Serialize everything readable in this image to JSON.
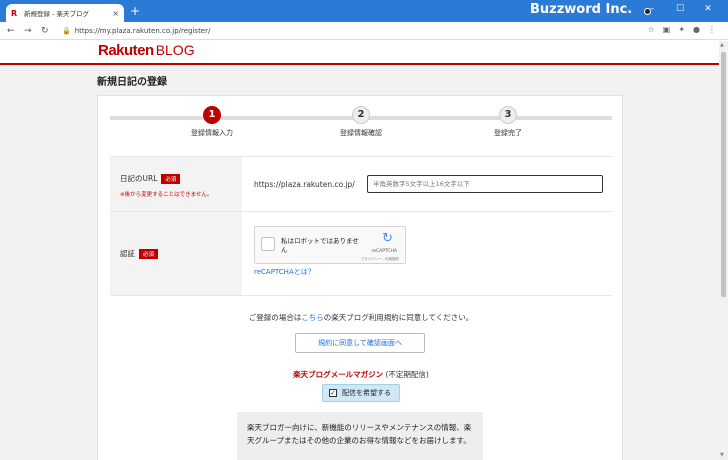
{
  "browser": {
    "tab_title": "新規登録 - 楽天ブログ",
    "tab_favicon": "R",
    "close_glyph": "×",
    "newtab_glyph": "+",
    "url": "https://my.plaza.rakuten.co.jp/register/",
    "watermark": "Buzzword Inc.",
    "min_glyph": "–",
    "max_glyph": "☐",
    "winclose_glyph": "✕",
    "back_glyph": "←",
    "forward_glyph": "→",
    "reload_glyph": "↻",
    "lock_glyph": "🔒",
    "star_glyph": "☆",
    "ext1_glyph": "▣",
    "ext2_glyph": "✦",
    "ext3_glyph": "●",
    "menu_glyph": "⋮"
  },
  "header": {
    "logo_main": "Rakuten",
    "logo_sub": "BLOG"
  },
  "page_title": "新規日記の登録",
  "steps": [
    {
      "number": "1",
      "label": "登録情報入力"
    },
    {
      "number": "2",
      "label": "登録情報確認"
    },
    {
      "number": "3",
      "label": "登録完了"
    }
  ],
  "form": {
    "url_label": "日記のURL",
    "required": "必須",
    "url_note": "※後から変更することはできません。",
    "url_prefix": "https://plaza.rakuten.co.jp/",
    "url_placeholder": "半角英数字5文字以上16文字以下",
    "auth_label": "認証",
    "recaptcha_text": "私はロボットではありません",
    "recaptcha_logo": "↻",
    "recaptcha_brand": "reCAPTCHA",
    "recaptcha_terms": "プライバシー - 利用規約",
    "recaptcha_link": "reCAPTCHAとは？"
  },
  "agreement": {
    "text_before": "ご登録の場合は",
    "link": "こちら",
    "text_after": "の楽天ブログ利用規約に同意してください。",
    "button": "規約に同意して確認画面へ"
  },
  "magazine": {
    "title": "楽天ブログメールマガジン",
    "title_note": " (不定期配信)",
    "checkbox_label": "配信を希望する",
    "check_glyph": "✓",
    "description": "楽天ブロガー向けに、新機能のリリースやメンテナンスの情報、楽天グループまたはその他の企業のお得な情報などをお届けします。"
  },
  "scroll": {
    "up_glyph": "▲",
    "down_glyph": "▼"
  }
}
